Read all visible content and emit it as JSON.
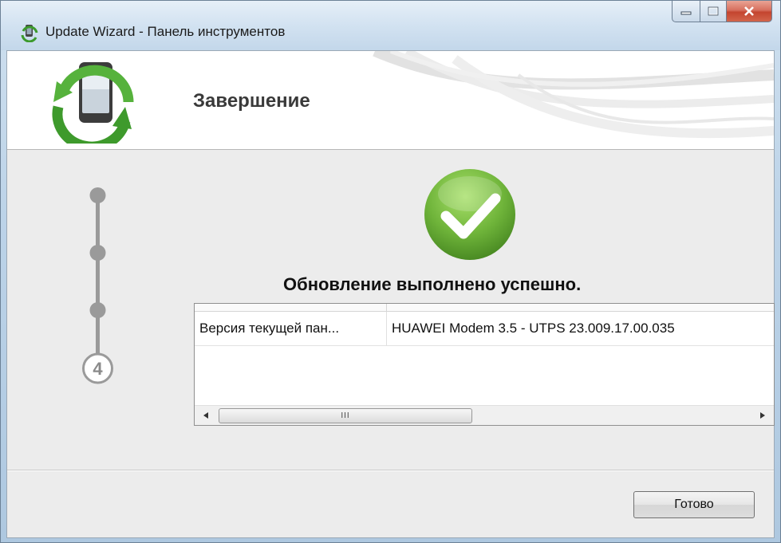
{
  "window": {
    "title": "Update Wizard - Панель инструментов"
  },
  "header": {
    "title": "Завершение"
  },
  "stepper": {
    "current_step": "4"
  },
  "main": {
    "success_message": "Обновление выполнено успешно.",
    "table": {
      "rows": [
        {
          "name": "Версия текущей пан...",
          "value": "HUAWEI Modem 3.5 - UTPS 23.009.17.00.035"
        }
      ],
      "scroll_thumb_grip": "III"
    }
  },
  "footer": {
    "done_label": "Готово"
  },
  "icons": {
    "app": "phone-update-icon",
    "header_logo": "phone-sync-logo-icon",
    "success": "checkmark-icon"
  },
  "colors": {
    "success_green": "#6fb43a",
    "sync_green": "#4e9a2f",
    "step_gray": "#9a9a9a"
  }
}
